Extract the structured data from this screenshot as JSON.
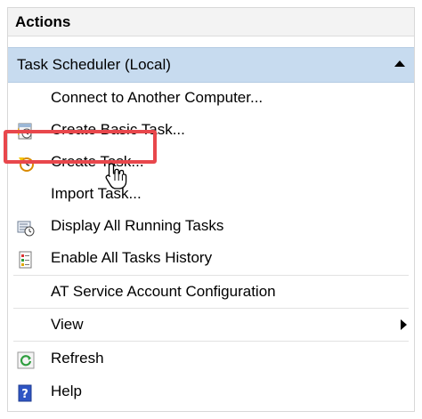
{
  "panel": {
    "title": "Actions"
  },
  "section": {
    "title": "Task Scheduler (Local)",
    "collapse_icon": "chevron-up-icon"
  },
  "items": [
    {
      "label": "Connect to Another Computer...",
      "icon": "none"
    },
    {
      "label": "Create Basic Task...",
      "icon": "basic-task-wizard-icon"
    },
    {
      "label": "Create Task...",
      "icon": "create-task-icon"
    },
    {
      "label": "Import Task...",
      "icon": "none"
    },
    {
      "label": "Display All Running Tasks",
      "icon": "running-tasks-icon"
    },
    {
      "label": "Enable All Tasks History",
      "icon": "tasks-history-icon"
    },
    {
      "label": "AT Service Account Configuration",
      "icon": "none"
    },
    {
      "label": "View",
      "icon": "submenu-arrow-icon"
    },
    {
      "label": "Refresh",
      "icon": "refresh-icon"
    },
    {
      "label": "Help",
      "icon": "help-icon"
    }
  ],
  "colors": {
    "section_bg": "#c7dbef",
    "highlight": "#e8474c"
  }
}
